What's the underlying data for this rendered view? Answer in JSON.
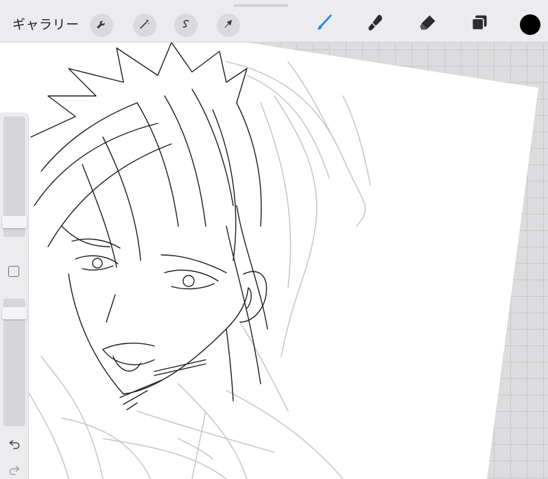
{
  "toolbar": {
    "gallery_label": "ギャラリー",
    "left_tools": [
      "wrench-icon",
      "magic-wand-icon",
      "selection-icon",
      "transform-arrow-icon"
    ],
    "right_tools": [
      "brush-icon",
      "smudge-icon",
      "eraser-icon",
      "layers-icon"
    ],
    "active_tool": "brush-icon",
    "current_color": "#000000",
    "active_color": "#1e88e5"
  },
  "sidebar": {
    "brush_size_fraction": 0.08,
    "opacity_fraction": 0.93,
    "tools": [
      "modify-button",
      "undo-icon",
      "redo-icon"
    ]
  },
  "canvas": {
    "content": "anime-character-sketch",
    "paper_color": "#ffffff",
    "line_color": "#1a1a1a",
    "sketch_color": "#c8c8c8"
  }
}
